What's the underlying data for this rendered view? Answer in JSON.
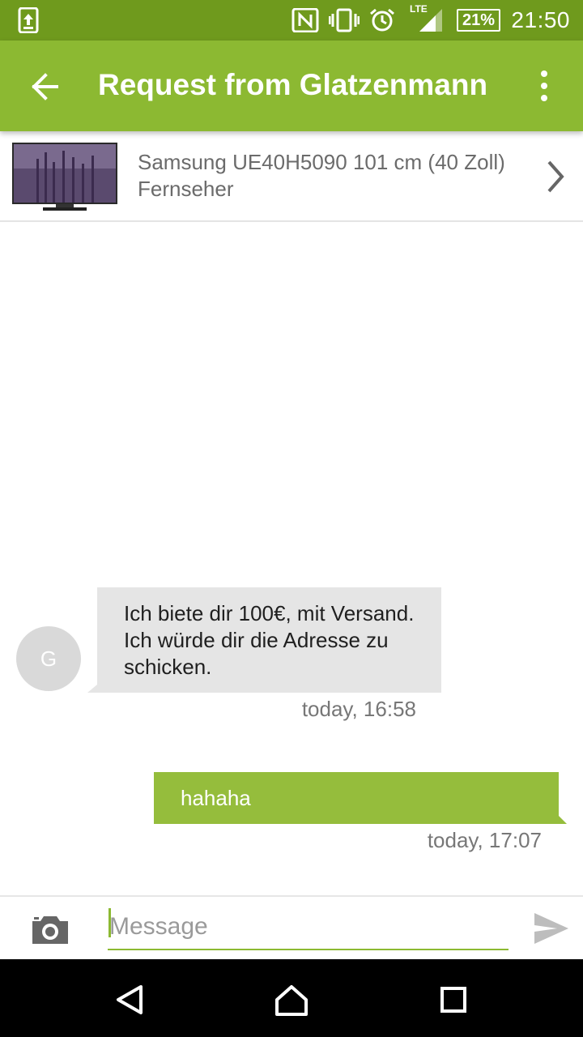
{
  "status_bar": {
    "battery": "21%",
    "network": "LTE",
    "time": "21:50",
    "background_color": "#6f9a1d"
  },
  "app_bar": {
    "title": "Request from Glatzenmann",
    "background_color": "#8cb932"
  },
  "product": {
    "name": "Samsung UE40H5090 101 cm (40 Zoll) Fernseher"
  },
  "messages": [
    {
      "direction": "incoming",
      "avatar_letter": "G",
      "text": "Ich biete dir 100€, mit Versand. Ich würde dir die Adresse zu schicken.",
      "time": "today, 16:58"
    },
    {
      "direction": "outgoing",
      "text": "hahaha",
      "time": "today, 17:07"
    }
  ],
  "composer": {
    "placeholder": "Message",
    "value": ""
  },
  "icons": {
    "status_left": "upload-icon",
    "nfc": "nfc-icon",
    "vibrate": "vibrate-icon",
    "alarm": "alarm-icon",
    "signal": "signal-icon",
    "back": "back-arrow-icon",
    "menu": "more-vert-icon",
    "chevron": "chevron-right-icon",
    "camera": "camera-icon",
    "send": "send-icon"
  }
}
